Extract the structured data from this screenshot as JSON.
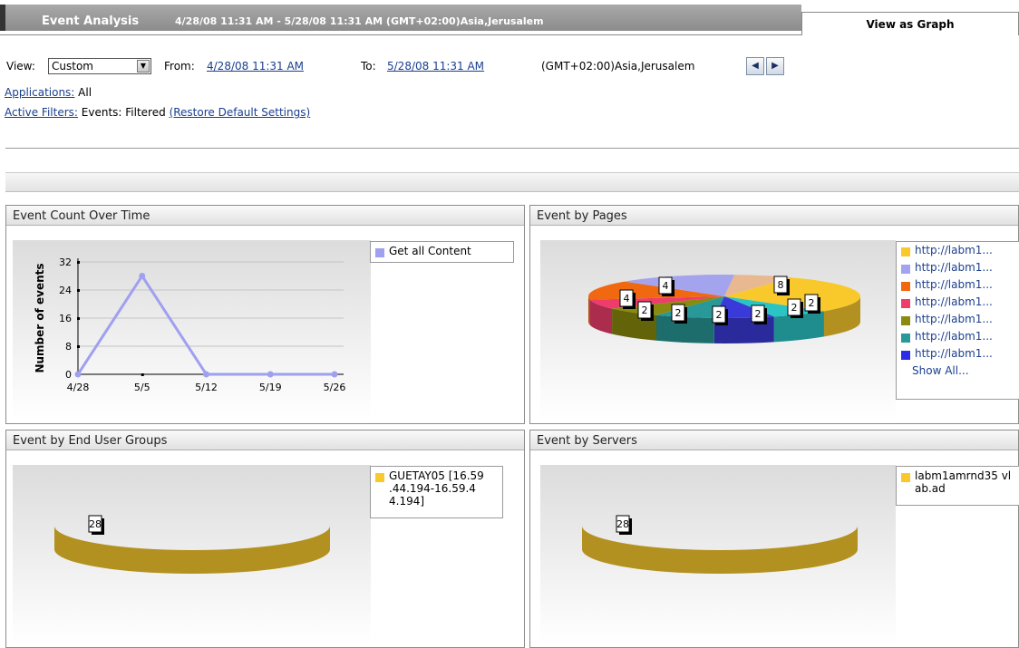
{
  "header": {
    "title": "Event Analysis",
    "range": "4/28/08 11:31 AM - 5/28/08 11:31 AM (GMT+02:00)Asia,Jerusalem",
    "tab_label": "View as Graph"
  },
  "filters": {
    "view_label": "View:",
    "view_value": "Custom",
    "from_label": "From:",
    "from_value": "4/28/08 11:31 AM",
    "to_label": "To:",
    "to_value": "5/28/08 11:31 AM",
    "timezone": "(GMT+02:00)Asia,Jerusalem",
    "applications_label": "Applications:",
    "applications_value": "All",
    "active_filters_label": "Active Filters:",
    "active_filters_value": "Events: Filtered",
    "restore_link": "(Restore Default Settings)"
  },
  "panels": {
    "count_title": "Event Count Over Time",
    "pages_title": "Event by Pages",
    "groups_title": "Event by End User Groups",
    "servers_title": "Event by Servers"
  },
  "legends": {
    "line": "Get all Content",
    "pages": [
      "http://labm1...",
      "http://labm1...",
      "http://labm1...",
      "http://labm1...",
      "http://labm1...",
      "http://labm1...",
      "http://labm1..."
    ],
    "pages_show_all": "Show All...",
    "groups": "GUETAY05 [16.59 .44.194-16.59.4 4.194]",
    "servers": "labm1amrnd35 vlab.ad"
  },
  "colors": {
    "line": "#a0a0f0",
    "pages": [
      "#f9c92c",
      "#a3a3ee",
      "#f06810",
      "#ee3d6a",
      "#8a8a0e",
      "#289898",
      "#2b2be8"
    ],
    "single_pie": "#f9c92c"
  },
  "icons": {
    "dropdown": "chevron-down-icon",
    "prev": "arrow-left-icon",
    "next": "arrow-right-icon"
  },
  "chart_data": [
    {
      "type": "line",
      "title": "Event Count Over Time",
      "xlabel": "",
      "ylabel": "Number of events",
      "categories": [
        "4/28",
        "5/5",
        "5/12",
        "5/19",
        "5/26"
      ],
      "series": [
        {
          "name": "Get all Content",
          "x": [
            "4/28",
            "5/5",
            "5/12",
            "5/19",
            "5/26"
          ],
          "values": [
            0,
            28,
            0,
            0,
            0
          ]
        }
      ],
      "ylim": [
        0,
        32
      ],
      "yticks": [
        0,
        8,
        16,
        24,
        32
      ],
      "grid": true,
      "legend": "right"
    },
    {
      "type": "pie",
      "title": "Event by Pages",
      "labels": [
        "4",
        "4",
        "8",
        "2",
        "2",
        "2",
        "2",
        "2",
        "2"
      ],
      "values": [
        8,
        4,
        4,
        2,
        2,
        2,
        2,
        2,
        2
      ],
      "legend": "right"
    },
    {
      "type": "pie",
      "title": "Event by End User Groups",
      "labels": [
        "GUETAY05 [16.59 .44.194-16.59.4 4.194]"
      ],
      "values": [
        28
      ],
      "data_labels": [
        "28"
      ],
      "legend": "right"
    },
    {
      "type": "pie",
      "title": "Event by Servers",
      "labels": [
        "labm1amrnd35 vlab.ad"
      ],
      "values": [
        28
      ],
      "data_labels": [
        "28"
      ],
      "legend": "right"
    }
  ]
}
